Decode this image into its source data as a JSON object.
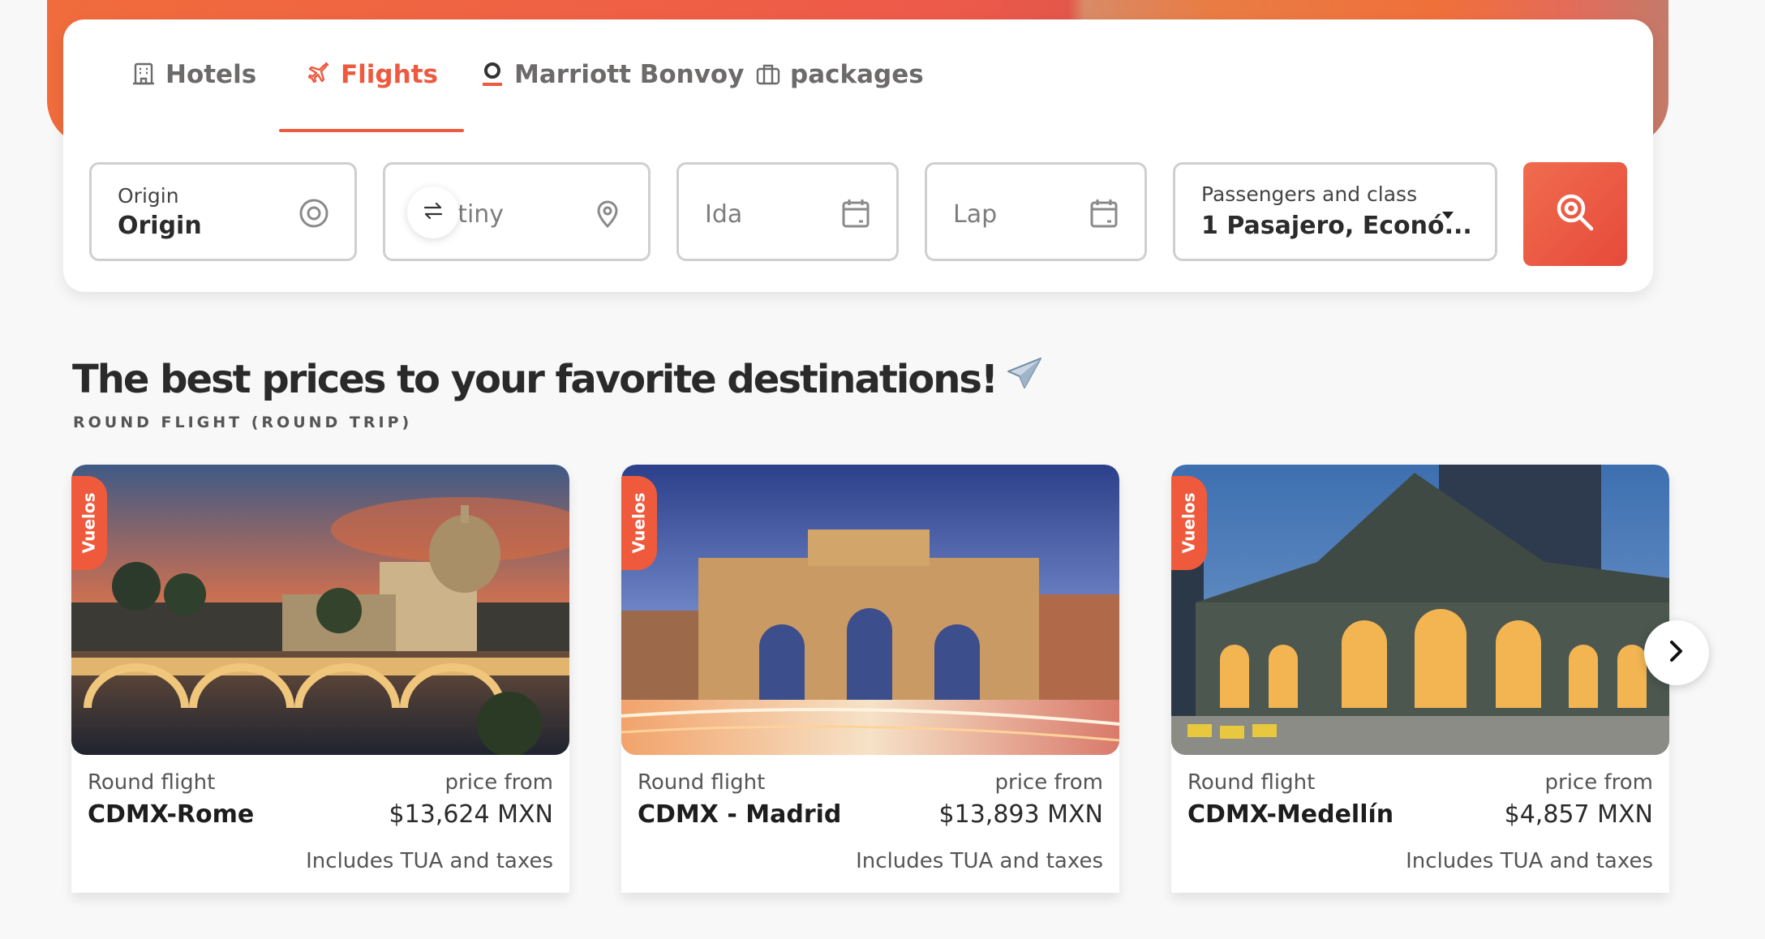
{
  "tabs": [
    {
      "label": "Hotels",
      "icon": "hotel-icon"
    },
    {
      "label": "Flights",
      "icon": "plane-icon",
      "active": true
    },
    {
      "label": "Marriott Bonvoy",
      "icon": "bonvoy-icon"
    },
    {
      "label": "packages",
      "icon": "suitcase-icon"
    }
  ],
  "search": {
    "origin_label": "Origin",
    "origin_value": "Origin",
    "destiny_placeholder": "Destiny",
    "ida_placeholder": "Ida",
    "lap_placeholder": "Lap",
    "passengers_label": "Passengers and class",
    "passengers_value": "1 Pasajero, Econó..."
  },
  "section": {
    "title": "The best prices to your favorite destinations!",
    "title_emoji": "✈️",
    "subtitle": "ROUND FLIGHT (ROUND TRIP)"
  },
  "cards": [
    {
      "badge": "Vuelos",
      "kind": "Round flight",
      "route": "CDMX-Rome",
      "price_label": "price from",
      "price": "$13,624 MXN",
      "taxes": "Includes TUA and taxes"
    },
    {
      "badge": "Vuelos",
      "kind": "Round flight",
      "route": "CDMX - Madrid",
      "price_label": "price from",
      "price": "$13,893 MXN",
      "taxes": "Includes TUA and taxes"
    },
    {
      "badge": "Vuelos",
      "kind": "Round flight",
      "route": "CDMX-Medellín",
      "price_label": "price from",
      "price": "$4,857 MXN",
      "taxes": "Includes TUA and taxes"
    }
  ],
  "colors": {
    "accent": "#ee5a3f",
    "border": "#cfcfcf"
  }
}
